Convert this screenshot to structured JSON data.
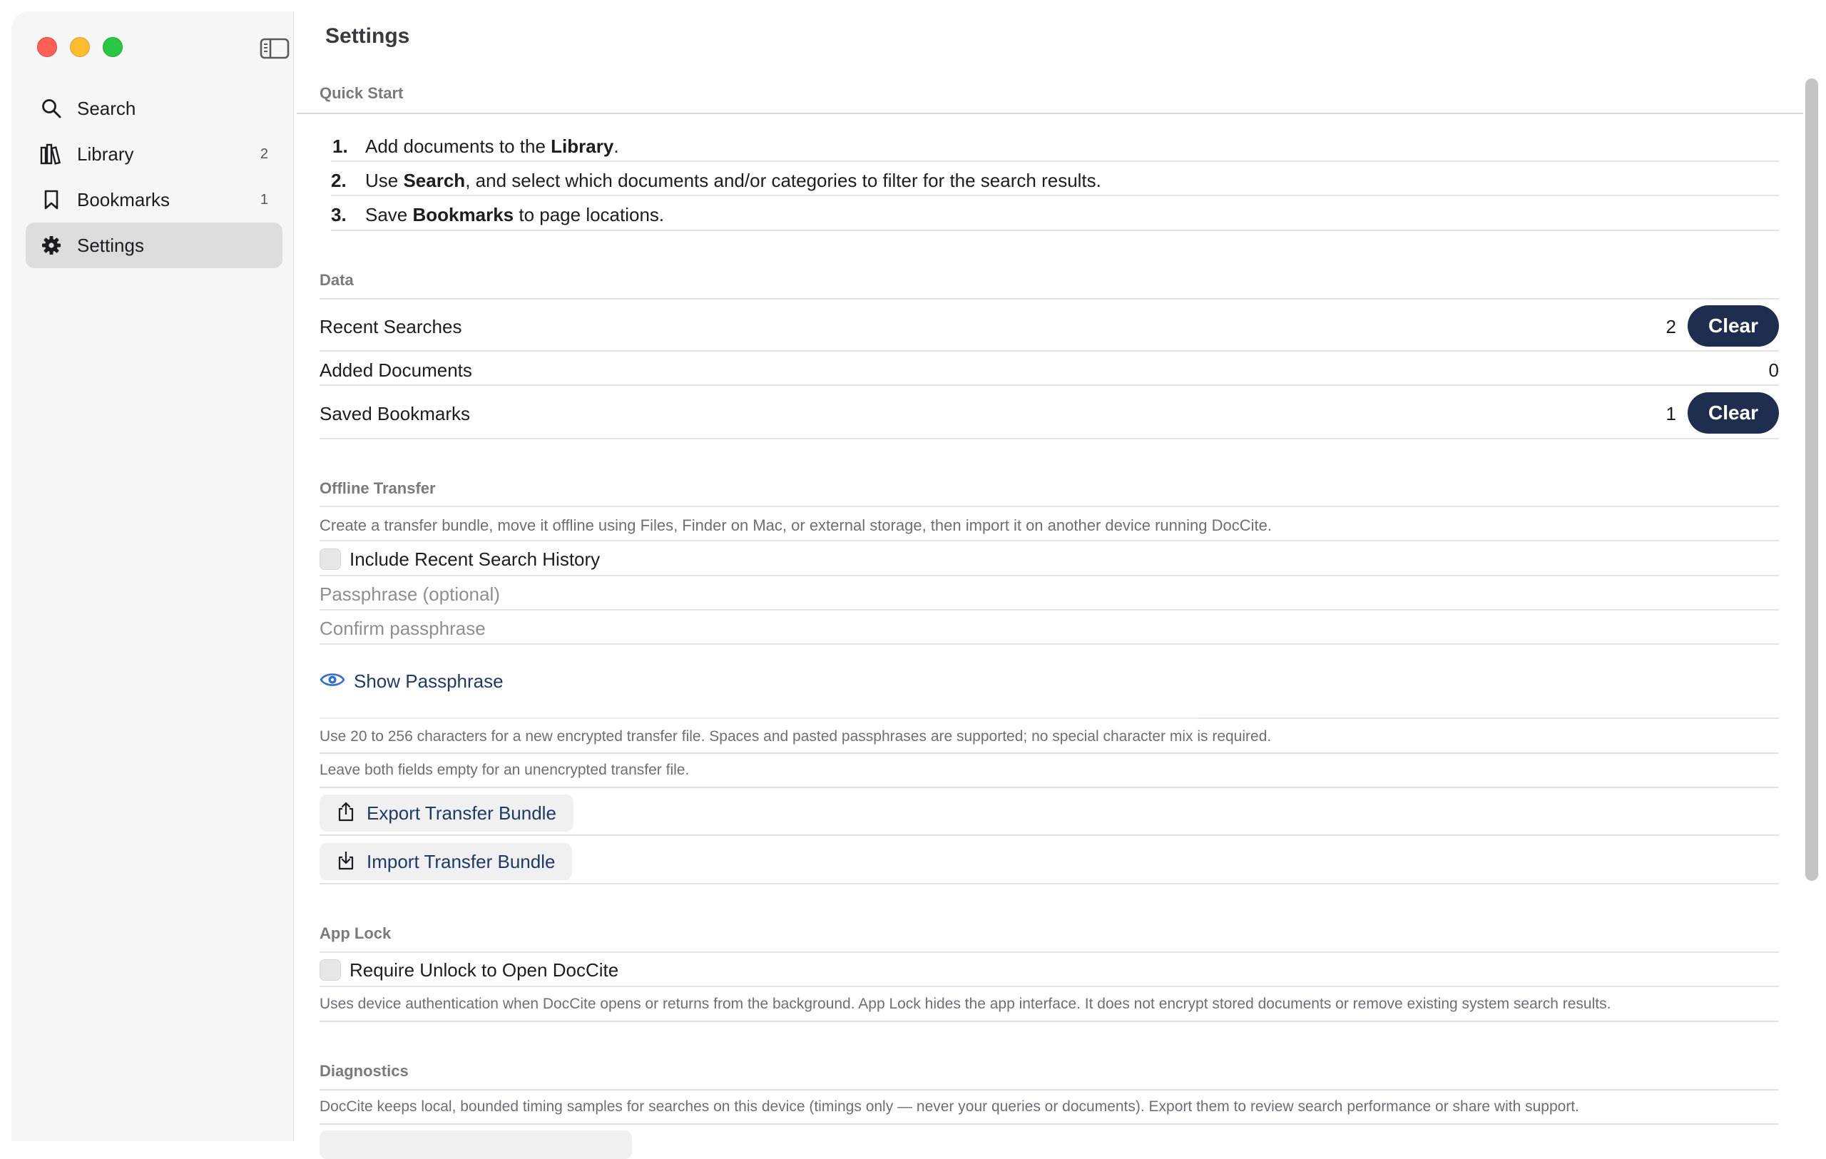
{
  "window": {
    "controls": [
      "close",
      "minimize",
      "maximize"
    ]
  },
  "sidebar": {
    "toggle_icon": "sidebar-icon",
    "items": [
      {
        "label": "Search",
        "icon": "search-icon",
        "count": ""
      },
      {
        "label": "Library",
        "icon": "library-icon",
        "count": "2"
      },
      {
        "label": "Bookmarks",
        "icon": "bookmark-icon",
        "count": "1"
      },
      {
        "label": "Settings",
        "icon": "gear-icon",
        "count": "",
        "active": true
      }
    ]
  },
  "page": {
    "title": "Settings"
  },
  "quick_start": {
    "label": "Quick Start",
    "steps": [
      {
        "num": "1.",
        "pre": "Add documents to the ",
        "bold": "Library",
        "post": "."
      },
      {
        "num": "2.",
        "pre": "Use ",
        "bold": "Search",
        "post": ", and select which documents and/or categories to filter for the search results."
      },
      {
        "num": "3.",
        "pre": "Save ",
        "bold": "Bookmarks",
        "post": " to page locations."
      }
    ]
  },
  "data_section": {
    "label": "Data",
    "rows": [
      {
        "label": "Recent Searches",
        "value": "2",
        "button": "Clear"
      },
      {
        "label": "Added Documents",
        "value": "0",
        "button": ""
      },
      {
        "label": "Saved Bookmarks",
        "value": "1",
        "button": "Clear"
      }
    ]
  },
  "offline_transfer": {
    "label": "Offline Transfer",
    "description": "Create a transfer bundle, move it offline using Files, Finder on Mac, or external storage, then import it on another device running DocCite.",
    "include_history_label": "Include Recent Search History",
    "include_history_checked": false,
    "passphrase_placeholder": "Passphrase (optional)",
    "confirm_placeholder": "Confirm passphrase",
    "show_passphrase_label": "Show Passphrase",
    "hint_1": "Use 20 to 256 characters for a new encrypted transfer file. Spaces and pasted passphrases are supported; no special character mix is required.",
    "hint_2": "Leave both fields empty for an unencrypted transfer file.",
    "export_label": "Export Transfer Bundle",
    "import_label": "Import Transfer Bundle"
  },
  "app_lock": {
    "label": "App Lock",
    "require_unlock_label": "Require Unlock to Open DocCite",
    "require_unlock_checked": false,
    "description": "Uses device authentication when DocCite opens or returns from the background. App Lock hides the app interface. It does not encrypt stored documents or remove existing system search results."
  },
  "diagnostics": {
    "label": "Diagnostics",
    "description": "DocCite keeps local, bounded timing samples for searches on this device (timings only — never your queries or documents). Export them to review search performance or share with support."
  },
  "colors": {
    "accent_dark": "#1f2e4e",
    "link": "#1f3a66",
    "link_icon": "#2f6fd6",
    "sidebar_bg": "#f6f6f6"
  }
}
